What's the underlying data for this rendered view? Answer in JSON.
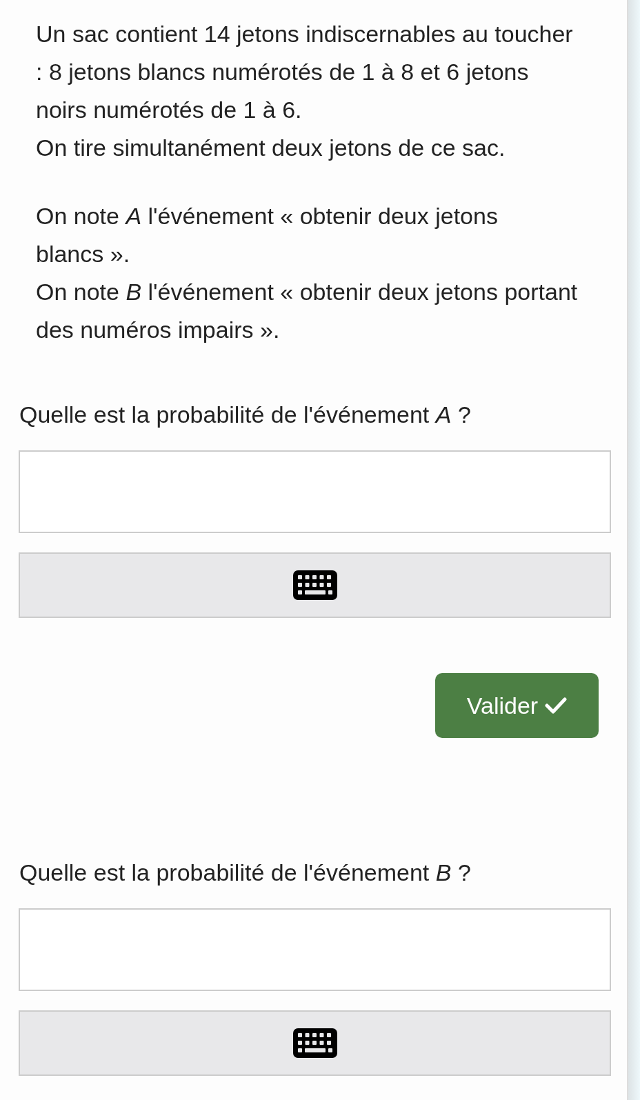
{
  "statement": [
    "Un sac contient 14 jetons indiscernables au toucher : 8 jetons blancs numérotés de 1 à 8 et 6 jetons noirs numérotés de 1 à 6.",
    "On tire simultanément deux jetons de ce sac."
  ],
  "events": [
    "On note *A* l'événement « obtenir deux jetons blancs ».",
    "On note *B* l'événement « obtenir deux jetons portant des numéros impairs »."
  ],
  "questions": [
    {
      "prompt": "Quelle est la probabilité de l'événement *A* ?",
      "submit": "Valider"
    },
    {
      "prompt": "Quelle est la probabilité de l'événement *B* ?"
    }
  ]
}
